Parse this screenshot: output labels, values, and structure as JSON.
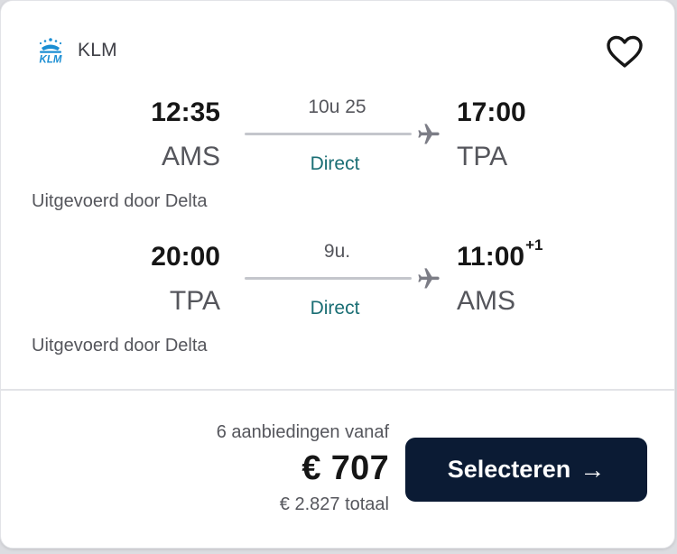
{
  "airline": {
    "name": "KLM",
    "logo_text": "KLM",
    "logo_color": "#1b8ed3",
    "icon": "klm-crown-logo"
  },
  "favorite": {
    "icon": "heart-outline-icon"
  },
  "legs": [
    {
      "departure_time": "12:35",
      "departure_airport": "AMS",
      "duration": "10u 25",
      "stops": "Direct",
      "arrival_time": "17:00",
      "arrival_day_offset": "",
      "arrival_airport": "TPA",
      "operated_by": "Uitgevoerd door Delta"
    },
    {
      "departure_time": "20:00",
      "departure_airport": "TPA",
      "duration": "9u.",
      "stops": "Direct",
      "arrival_time": "11:00",
      "arrival_day_offset": "+1",
      "arrival_airport": "AMS",
      "operated_by": "Uitgevoerd door Delta"
    }
  ],
  "pricing": {
    "offers_text": "6 aanbiedingen vanaf",
    "price": "€ 707",
    "total": "€ 2.827 totaal"
  },
  "select_button": {
    "label": "Selecteren",
    "arrow": "→",
    "icon": "arrow-right-icon"
  },
  "colors": {
    "button_bg": "#0b1b34",
    "stops_text": "#1a6e74",
    "klm_blue": "#1b8ed3"
  }
}
